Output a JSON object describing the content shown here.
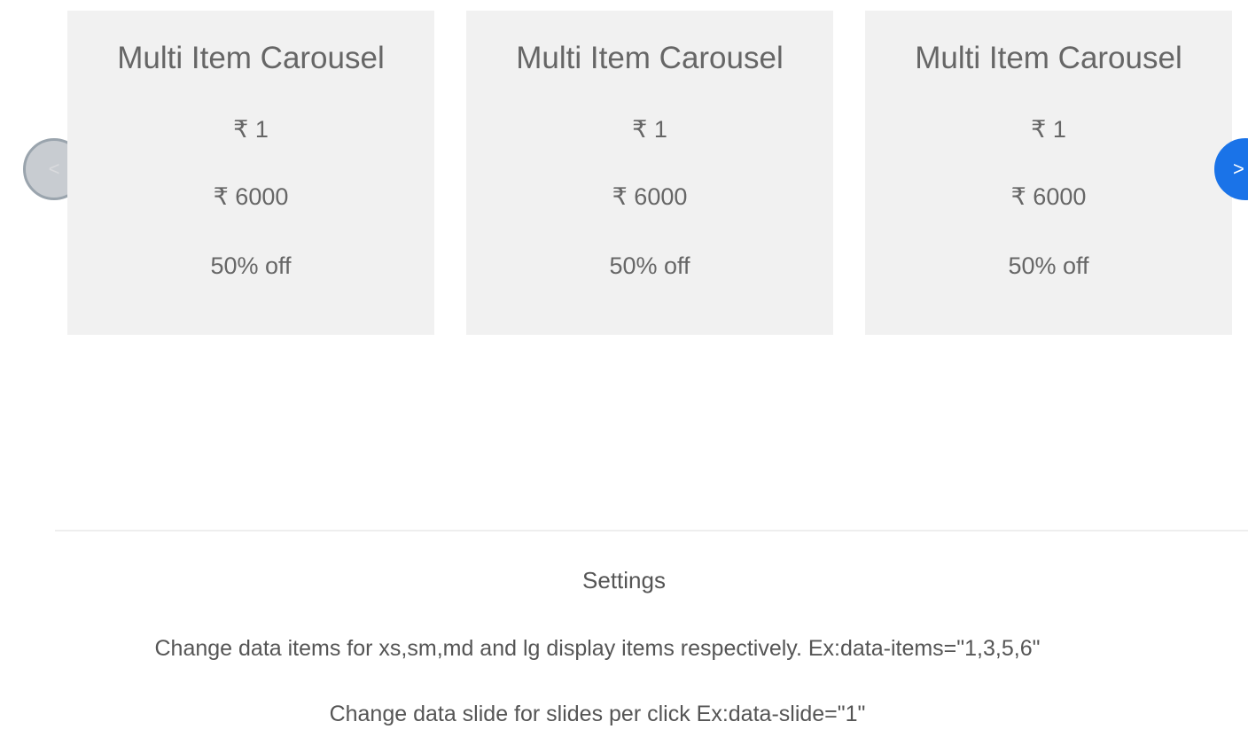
{
  "carousel": {
    "prev_icon": "chevron-left",
    "prev_label": "<",
    "next_icon": "chevron-right",
    "next_label": ">",
    "items": [
      {
        "title": "Multi Item Carousel",
        "price": "₹ 1",
        "mrp": "₹ 6000",
        "discount": "50% off"
      },
      {
        "title": "Multi Item Carousel",
        "price": "₹ 1",
        "mrp": "₹ 6000",
        "discount": "50% off"
      },
      {
        "title": "Multi Item Carousel",
        "price": "₹ 1",
        "mrp": "₹ 6000",
        "discount": "50% off"
      }
    ]
  },
  "settings": {
    "title": "Settings",
    "line1": "Change data items for xs,sm,md and lg display items respectively. Ex:data-items=\"1,3,5,6\"",
    "line2": "Change data slide for slides per click Ex:data-slide=\"1\""
  },
  "colors": {
    "card_background": "#f1f1f1",
    "next_button": "#1a73e8",
    "prev_button": "#c8ccd1"
  }
}
